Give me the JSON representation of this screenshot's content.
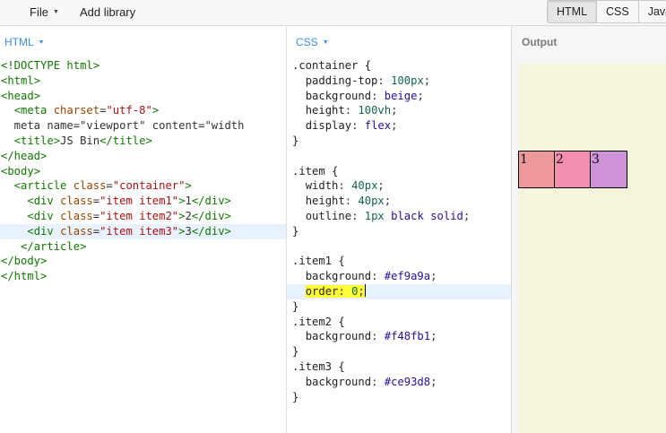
{
  "toolbar": {
    "file_label": "File",
    "add_library_label": "Add library",
    "toggles": [
      "HTML",
      "CSS",
      "Java"
    ]
  },
  "html_panel": {
    "label": "HTML",
    "lines": [
      "<!DOCTYPE html>",
      "<html>",
      "<head>",
      "  <meta charset=\"utf-8\">",
      "  <meta name=\"viewport\" content=\"width",
      "  <title>JS Bin</title>",
      "</head>",
      "<body>",
      "  <article class=\"container\">",
      "    <div class=\"item item1\">1</div>",
      "    <div class=\"item item2\">2</div>",
      "    <div class=\"item item3\">3</div>",
      "   </article>",
      "</body>",
      "</html>"
    ]
  },
  "css_panel": {
    "label": "CSS",
    "lines": [
      ".container {",
      "  padding-top: 100px;",
      "  background: beige;",
      "  height: 100vh;",
      "  display: flex;",
      "}",
      "",
      ".item {",
      "  width: 40px;",
      "  height: 40px;",
      "  outline: 1px black solid;",
      "}",
      "",
      ".item1 {",
      "  background: #ef9a9a;",
      "  order: 0;",
      "}",
      ".item2 {",
      "  background: #f48fb1;",
      "}",
      ".item3 {",
      "  background: #ce93d8;",
      "}"
    ]
  },
  "output_panel": {
    "label": "Output",
    "items": [
      {
        "text": "1",
        "color": "#ef9a9a"
      },
      {
        "text": "2",
        "color": "#f48fb1"
      },
      {
        "text": "3",
        "color": "#ce93d8"
      }
    ],
    "background": "#f5f5dc"
  },
  "colors": {
    "accent": "#3a8ee6",
    "highlight": "#ffff3a"
  }
}
